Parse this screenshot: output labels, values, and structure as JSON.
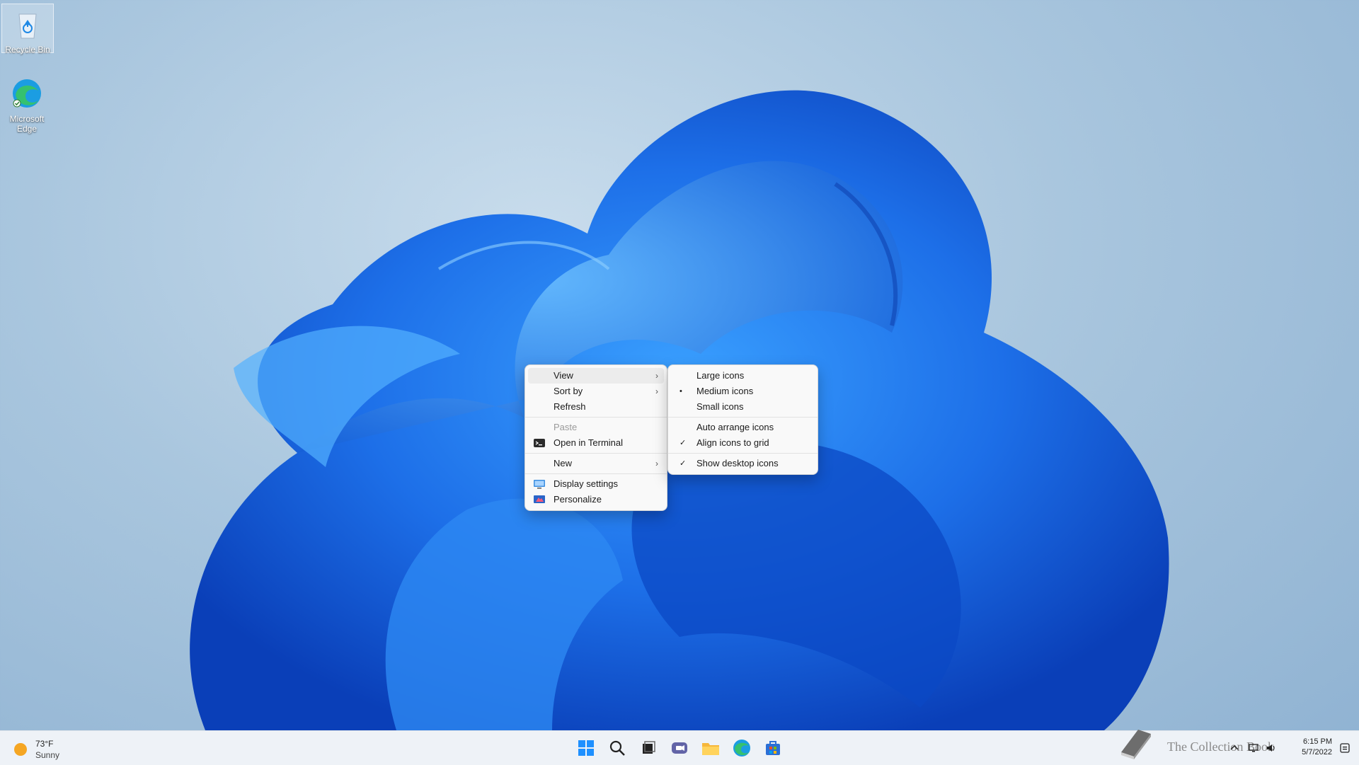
{
  "desktop": {
    "icons": [
      {
        "label": "Recycle Bin",
        "icon": "recycle-bin-icon"
      },
      {
        "label": "Microsoft Edge",
        "icon": "edge-icon"
      }
    ]
  },
  "context_menu": {
    "items": [
      {
        "label": "View",
        "submenu": true
      },
      {
        "label": "Sort by",
        "submenu": true
      },
      {
        "label": "Refresh"
      },
      {
        "label": "Paste",
        "disabled": true
      },
      {
        "label": "Open in Terminal",
        "icon": "terminal-icon"
      },
      {
        "label": "New",
        "submenu": true
      },
      {
        "label": "Display settings",
        "icon": "display-icon"
      },
      {
        "label": "Personalize",
        "icon": "personalize-icon"
      }
    ]
  },
  "view_submenu": {
    "items": [
      {
        "label": "Large icons",
        "checked": false
      },
      {
        "label": "Medium icons",
        "checked": true,
        "mark": "•"
      },
      {
        "label": "Small icons",
        "checked": false
      },
      {
        "label": "Auto arrange icons",
        "checked": false
      },
      {
        "label": "Align icons to grid",
        "checked": true,
        "mark": "✓"
      },
      {
        "label": "Show desktop icons",
        "checked": true,
        "mark": "✓"
      }
    ]
  },
  "taskbar": {
    "weather": {
      "temp": "73°F",
      "condition": "Sunny"
    },
    "apps": [
      "start-icon",
      "search-icon",
      "task-view-icon",
      "chat-icon",
      "file-explorer-icon",
      "edge-icon",
      "store-icon"
    ],
    "clock": {
      "time": "6:15 PM",
      "date": "5/7/2022"
    },
    "watermark": "The Collection Book"
  },
  "colors": {
    "menu_bg": "#f9f9f9",
    "accent": "#0078d4"
  }
}
